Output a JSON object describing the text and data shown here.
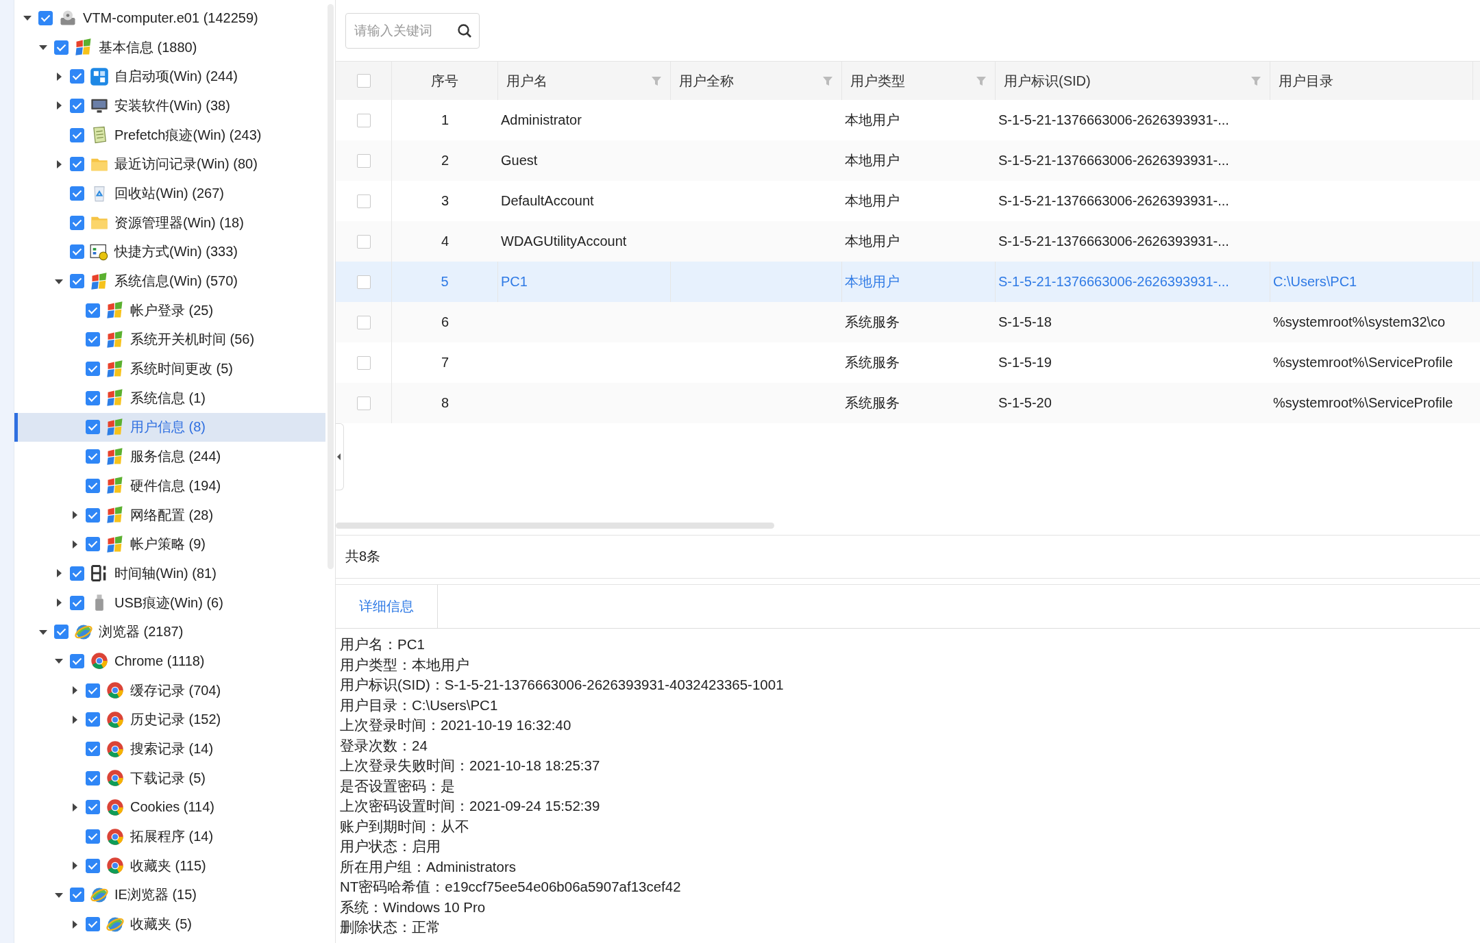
{
  "tree": [
    {
      "label": "VTM-computer.e01 (142259)",
      "kind": "drive",
      "checked": true,
      "selected": false,
      "expanded": true,
      "children": [
        {
          "label": "基本信息 (1880)",
          "kind": "windows",
          "checked": true,
          "selected": false,
          "expanded": true,
          "children": [
            {
              "label": "自启动项(Win) (244)",
              "kind": "startup",
              "checked": true,
              "selected": false,
              "expanded": false
            },
            {
              "label": "安装软件(Win) (38)",
              "kind": "monitor",
              "checked": true,
              "selected": false,
              "expanded": false
            },
            {
              "label": "Prefetch痕迹(Win) (243)",
              "kind": "note",
              "checked": true,
              "selected": false
            },
            {
              "label": "最近访问记录(Win) (80)",
              "kind": "folder",
              "checked": true,
              "selected": false,
              "expanded": false
            },
            {
              "label": "回收站(Win) (267)",
              "kind": "recycle",
              "checked": true,
              "selected": false
            },
            {
              "label": "资源管理器(Win) (18)",
              "kind": "folder",
              "checked": true,
              "selected": false
            },
            {
              "label": "快捷方式(Win) (333)",
              "kind": "shortcut",
              "checked": true,
              "selected": false
            },
            {
              "label": "系统信息(Win) (570)",
              "kind": "windows",
              "checked": true,
              "selected": false,
              "expanded": true,
              "children": [
                {
                  "label": "帐户登录 (25)",
                  "kind": "windows",
                  "checked": true,
                  "selected": false
                },
                {
                  "label": "系统开关机时间 (56)",
                  "kind": "windows",
                  "checked": true,
                  "selected": false
                },
                {
                  "label": "系统时间更改 (5)",
                  "kind": "windows",
                  "checked": true,
                  "selected": false
                },
                {
                  "label": "系统信息 (1)",
                  "kind": "windows",
                  "checked": true,
                  "selected": false
                },
                {
                  "label": "用户信息 (8)",
                  "kind": "windows",
                  "checked": true,
                  "selected": true
                },
                {
                  "label": "服务信息 (244)",
                  "kind": "windows",
                  "checked": true,
                  "selected": false
                },
                {
                  "label": "硬件信息 (194)",
                  "kind": "windows",
                  "checked": true,
                  "selected": false
                },
                {
                  "label": "网络配置 (28)",
                  "kind": "windows",
                  "checked": true,
                  "selected": false,
                  "expanded": false
                },
                {
                  "label": "帐户策略 (9)",
                  "kind": "windows",
                  "checked": true,
                  "selected": false,
                  "expanded": false
                }
              ]
            },
            {
              "label": "时间轴(Win) (81)",
              "kind": "timeline",
              "checked": true,
              "selected": false,
              "expanded": false
            },
            {
              "label": "USB痕迹(Win) (6)",
              "kind": "usb",
              "checked": true,
              "selected": false,
              "expanded": false
            }
          ]
        },
        {
          "label": "浏览器 (2187)",
          "kind": "ie",
          "checked": true,
          "selected": false,
          "expanded": true,
          "children": [
            {
              "label": "Chrome (1118)",
              "kind": "chrome",
              "checked": true,
              "selected": false,
              "expanded": true,
              "children": [
                {
                  "label": "缓存记录 (704)",
                  "kind": "chrome",
                  "checked": true,
                  "selected": false,
                  "expanded": false
                },
                {
                  "label": "历史记录 (152)",
                  "kind": "chrome",
                  "checked": true,
                  "selected": false,
                  "expanded": false
                },
                {
                  "label": "搜索记录 (14)",
                  "kind": "chrome",
                  "checked": true,
                  "selected": false
                },
                {
                  "label": "下载记录 (5)",
                  "kind": "chrome",
                  "checked": true,
                  "selected": false
                },
                {
                  "label": "Cookies (114)",
                  "kind": "chrome",
                  "checked": true,
                  "selected": false,
                  "expanded": false
                },
                {
                  "label": "拓展程序 (14)",
                  "kind": "chrome",
                  "checked": true,
                  "selected": false
                },
                {
                  "label": "收藏夹 (115)",
                  "kind": "chrome",
                  "checked": true,
                  "selected": false,
                  "expanded": false
                }
              ]
            },
            {
              "label": "IE浏览器 (15)",
              "kind": "ie",
              "checked": true,
              "selected": false,
              "expanded": true,
              "children": [
                {
                  "label": "收藏夹 (5)",
                  "kind": "ie",
                  "checked": true,
                  "selected": false,
                  "expanded": false
                }
              ]
            }
          ]
        }
      ]
    }
  ],
  "search": {
    "placeholder": "请输入关键词"
  },
  "table": {
    "all_checked": false,
    "columns": [
      {
        "label": "序号",
        "filter": false
      },
      {
        "label": "用户名",
        "filter": true
      },
      {
        "label": "用户全称",
        "filter": true
      },
      {
        "label": "用户类型",
        "filter": true
      },
      {
        "label": "用户标识(SID)",
        "filter": true
      },
      {
        "label": "用户目录",
        "filter": false
      }
    ],
    "rows": [
      {
        "selected": false,
        "checked": false,
        "cells": [
          "1",
          "Administrator",
          "",
          "本地用户",
          "S-1-5-21-1376663006-2626393931-...",
          ""
        ]
      },
      {
        "selected": false,
        "checked": false,
        "cells": [
          "2",
          "Guest",
          "",
          "本地用户",
          "S-1-5-21-1376663006-2626393931-...",
          ""
        ]
      },
      {
        "selected": false,
        "checked": false,
        "cells": [
          "3",
          "DefaultAccount",
          "",
          "本地用户",
          "S-1-5-21-1376663006-2626393931-...",
          ""
        ]
      },
      {
        "selected": false,
        "checked": false,
        "cells": [
          "4",
          "WDAGUtilityAccount",
          "",
          "本地用户",
          "S-1-5-21-1376663006-2626393931-...",
          ""
        ]
      },
      {
        "selected": true,
        "checked": false,
        "cells": [
          "5",
          "PC1",
          "",
          "本地用户",
          "S-1-5-21-1376663006-2626393931-...",
          "C:\\Users\\PC1"
        ]
      },
      {
        "selected": false,
        "checked": false,
        "cells": [
          "6",
          "",
          "",
          "系统服务",
          "S-1-5-18",
          "%systemroot%\\system32\\co"
        ]
      },
      {
        "selected": false,
        "checked": false,
        "cells": [
          "7",
          "",
          "",
          "系统服务",
          "S-1-5-19",
          "%systemroot%\\ServiceProfile"
        ]
      },
      {
        "selected": false,
        "checked": false,
        "cells": [
          "8",
          "",
          "",
          "系统服务",
          "S-1-5-20",
          "%systemroot%\\ServiceProfile"
        ]
      }
    ]
  },
  "total": "共8条",
  "detail_tabs": [
    {
      "label": "详细信息",
      "selected": true
    }
  ],
  "details": [
    "用户名：PC1",
    "用户类型：本地用户",
    "用户标识(SID)：S-1-5-21-1376663006-2626393931-4032423365-1001",
    "用户目录：C:\\Users\\PC1",
    "上次登录时间：2021-10-19 16:32:40",
    "登录次数：24",
    "上次登录失败时间：2021-10-18 18:25:37",
    "是否设置密码：是",
    "上次密码设置时间：2021-09-24 15:52:39",
    "账户到期时间：从不",
    "用户状态：启用",
    "所在用户组：Administrators",
    "NT密码哈希值：e19ccf75ee54e06b06a5907af13cef42",
    "系统：Windows 10 Pro",
    "删除状态：正常"
  ]
}
